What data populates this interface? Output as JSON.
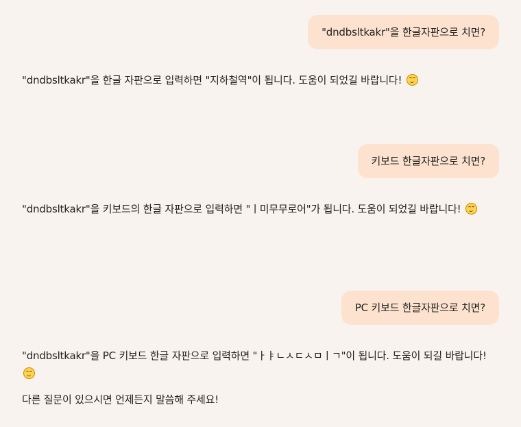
{
  "conversation": {
    "messages": [
      {
        "role": "user",
        "text": "\"dndbsltkakr\"을 한글자판으로 치면?"
      },
      {
        "role": "assistant",
        "text": "\"dndbsltkakr\"을 한글 자판으로 입력하면 \"지하철역\"이 됩니다. 도움이 되었길 바랍니다!",
        "emoji": "smiling-face-icon"
      },
      {
        "role": "user",
        "text": "키보드 한글자판으로 치면?"
      },
      {
        "role": "assistant",
        "text": "\"dndbsltkakr\"을 키보드의 한글 자판으로 입력하면 \"ㅣ미무무로어\"가 됩니다. 도움이 되었길 바랍니다!",
        "emoji": "smiling-face-icon"
      },
      {
        "role": "user",
        "text": "PC 키보드 한글자판으로 치면?"
      },
      {
        "role": "assistant",
        "text": "\"dndbsltkakr\"을 PC 키보드 한글 자판으로 입력하면 \"ㅏㅑㄴㅅㄷㅅㅁㅣㄱ\"이 됩니다. 도움이 되길 바랍니다!",
        "emoji": "smiling-face-icon",
        "followup": "다른 질문이 있으시면 언제든지 말씀해 주세요!"
      }
    ]
  },
  "colors": {
    "background": "#f9f3ef",
    "user_bubble": "#fde3cf",
    "text": "#1f1f1f"
  }
}
